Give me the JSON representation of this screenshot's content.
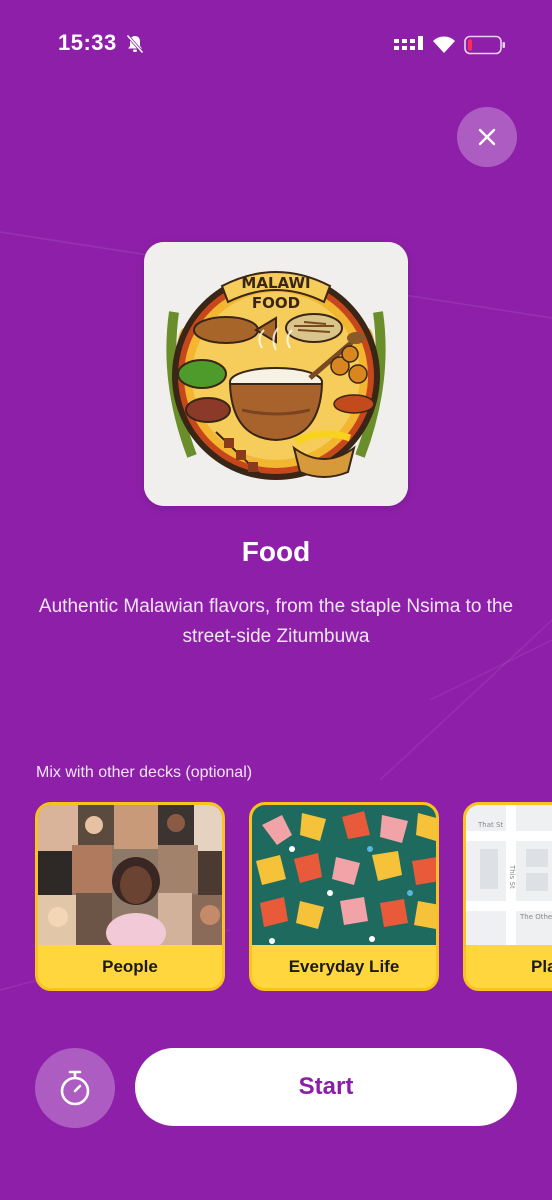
{
  "status_bar": {
    "time": "15:33",
    "icons": [
      "bell-muted-icon",
      "signal-icon",
      "wifi-icon",
      "battery-icon"
    ]
  },
  "close_icon": "close-icon",
  "deck": {
    "image_title_line1": "MALAWI",
    "image_title_line2": "FOOD",
    "title": "Food",
    "description": "Authentic Malawian flavors, from the staple Nsima to the street-side Zitumbuwa"
  },
  "mix": {
    "label": "Mix with other decks (optional)",
    "decks": [
      {
        "label": "People"
      },
      {
        "label": "Everyday Life"
      },
      {
        "label": "Places"
      }
    ],
    "map_labels": [
      "That St",
      "This St",
      "The Other St"
    ]
  },
  "actions": {
    "timer_icon": "stopwatch-icon",
    "start_label": "Start"
  },
  "colors": {
    "background": "#8e1fa9",
    "accent_yellow": "#ffd63d",
    "start_text": "#8a1ea8"
  }
}
